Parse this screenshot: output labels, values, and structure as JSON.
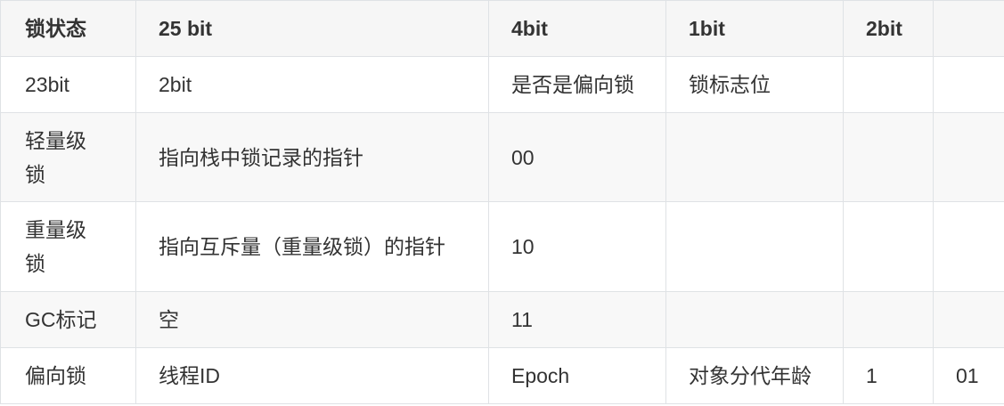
{
  "colors": {
    "header_bg": "#f6f6f6",
    "alt_row_bg": "#f8f8f8",
    "border": "#dfe2e5",
    "text": "#333333"
  },
  "table": {
    "headers": [
      "锁状态",
      "25 bit",
      "4bit",
      "1bit",
      "2bit",
      ""
    ],
    "rows": [
      [
        "23bit",
        "2bit",
        "是否是偏向锁",
        "锁标志位",
        "",
        ""
      ],
      [
        "轻量级锁",
        "指向栈中锁记录的指针",
        "00",
        "",
        "",
        ""
      ],
      [
        "重量级锁",
        "指向互斥量（重量级锁）的指针",
        "10",
        "",
        "",
        ""
      ],
      [
        "GC标记",
        "空",
        "11",
        "",
        "",
        ""
      ],
      [
        "偏向锁",
        "线程ID",
        "Epoch",
        "对象分代年龄",
        "1",
        "01"
      ]
    ]
  }
}
